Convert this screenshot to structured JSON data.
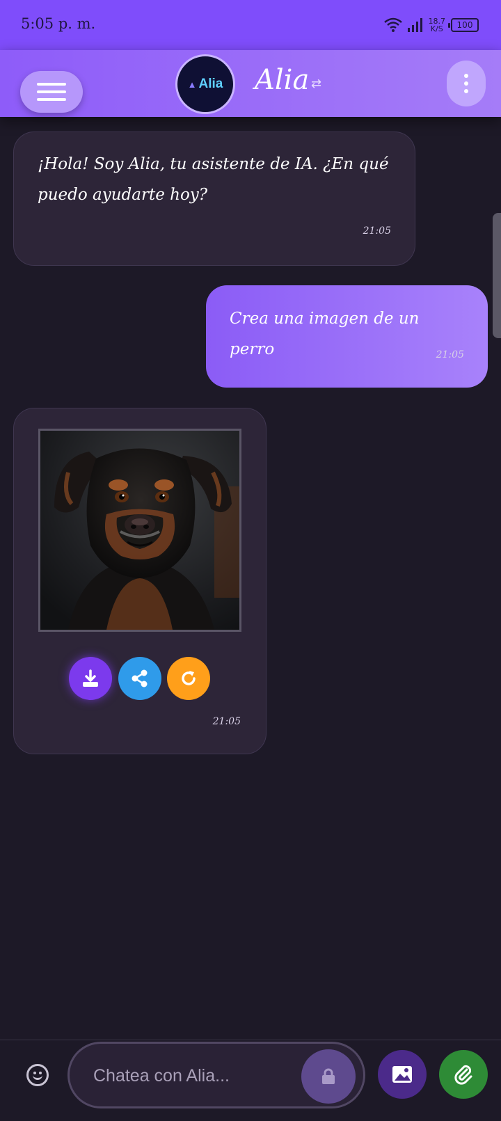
{
  "status_bar": {
    "time": "5:05 p. m.",
    "net_speed_value": "18.7",
    "net_speed_unit": "K/S",
    "battery": "100"
  },
  "header": {
    "logo_text": "Alia",
    "title": "Alia",
    "swap_symbol": "⇄"
  },
  "messages": [
    {
      "sender": "assistant",
      "text": "¡Hola! Soy Alia, tu asistente de IA. ¿En qué puedo ayudarte hoy?",
      "time": "21:05"
    },
    {
      "sender": "user",
      "text": "Crea una imagen de un perro",
      "time": "21:05"
    },
    {
      "sender": "assistant",
      "type": "image",
      "image_subject": "dog-portrait",
      "time": "21:05",
      "actions": [
        {
          "name": "download",
          "icon": "download-icon",
          "color": "#7c3aed"
        },
        {
          "name": "share",
          "icon": "share-icon",
          "color": "#2f9bea"
        },
        {
          "name": "regenerate",
          "icon": "refresh-icon",
          "color": "#ff9f1a"
        }
      ]
    }
  ],
  "composer": {
    "placeholder": "Chatea con Alia...",
    "value": ""
  },
  "colors": {
    "accent": "#7f4dfb",
    "background": "#1d1927",
    "assistant_bubble": "#2d2538",
    "user_bubble": "#8b5cf6",
    "attach_button": "#2e8b36"
  }
}
